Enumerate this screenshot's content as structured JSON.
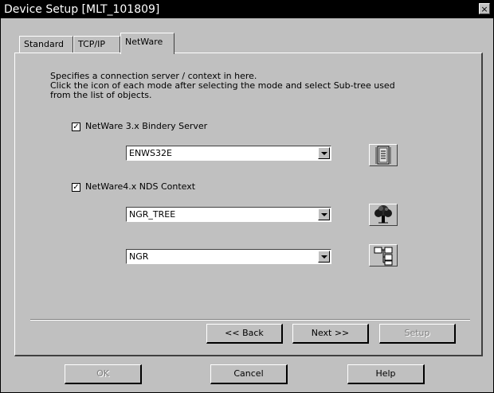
{
  "window": {
    "title": "Device Setup [MLT_101809]",
    "close_label": "×"
  },
  "tabs": [
    {
      "label": "Standard",
      "active": false
    },
    {
      "label": "TCP/IP",
      "active": false
    },
    {
      "label": "NetWare",
      "active": true
    }
  ],
  "description": {
    "line1": "Specifies a connection server / context in here.",
    "line2": "Click the icon of each mode after selecting the mode and select Sub-tree used",
    "line3": "from the list of objects."
  },
  "bindery": {
    "checkbox_label": "NetWare 3.x Bindery Server",
    "checked": true,
    "check_mark": "✓",
    "server_value": "ENWS32E",
    "icon": "server-icon"
  },
  "nds": {
    "checkbox_label": "NetWare4.x NDS Context",
    "checked": true,
    "check_mark": "✓",
    "tree_value": "NGR_TREE",
    "tree_icon": "tree-icon",
    "context_value": "NGR",
    "context_icon": "hierarchy-icon"
  },
  "wizard_buttons": {
    "back": "<< Back",
    "next": "Next >>",
    "setup": "Setup"
  },
  "dialog_buttons": {
    "ok": "OK",
    "cancel": "Cancel",
    "help": "Help"
  },
  "colors": {
    "window_bg": "#c0c0c0",
    "titlebar_bg": "#000000",
    "title_fg": "#ffffff"
  }
}
